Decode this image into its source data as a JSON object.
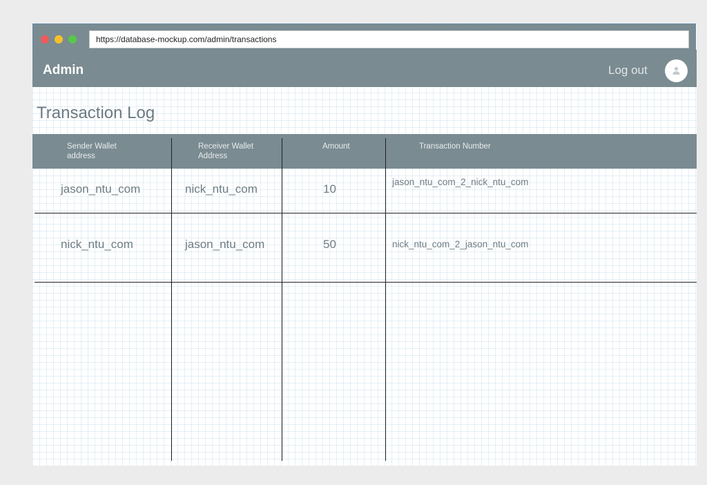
{
  "browser": {
    "url": "https://database-mockup.com/admin/transactions"
  },
  "header": {
    "brand": "Admin",
    "logout_label": "Log out",
    "avatar_icon": "user-icon"
  },
  "page": {
    "title": "Transaction Log"
  },
  "table": {
    "columns": [
      "Sender Wallet\naddress",
      "Receiver Wallet\nAddress",
      "Amount",
      "Transaction Number"
    ],
    "rows": [
      {
        "sender": "jason_ntu_com",
        "receiver": "nick_ntu_com",
        "amount": "10",
        "transaction_number": "jason_ntu_com_2_nick_ntu_com"
      },
      {
        "sender": "nick_ntu_com",
        "receiver": "jason_ntu_com",
        "amount": "50",
        "transaction_number": "nick_ntu_com_2_jason_ntu_com"
      }
    ]
  },
  "colors": {
    "header_bg": "#7a8b91",
    "text_muted": "#6e7c83"
  }
}
